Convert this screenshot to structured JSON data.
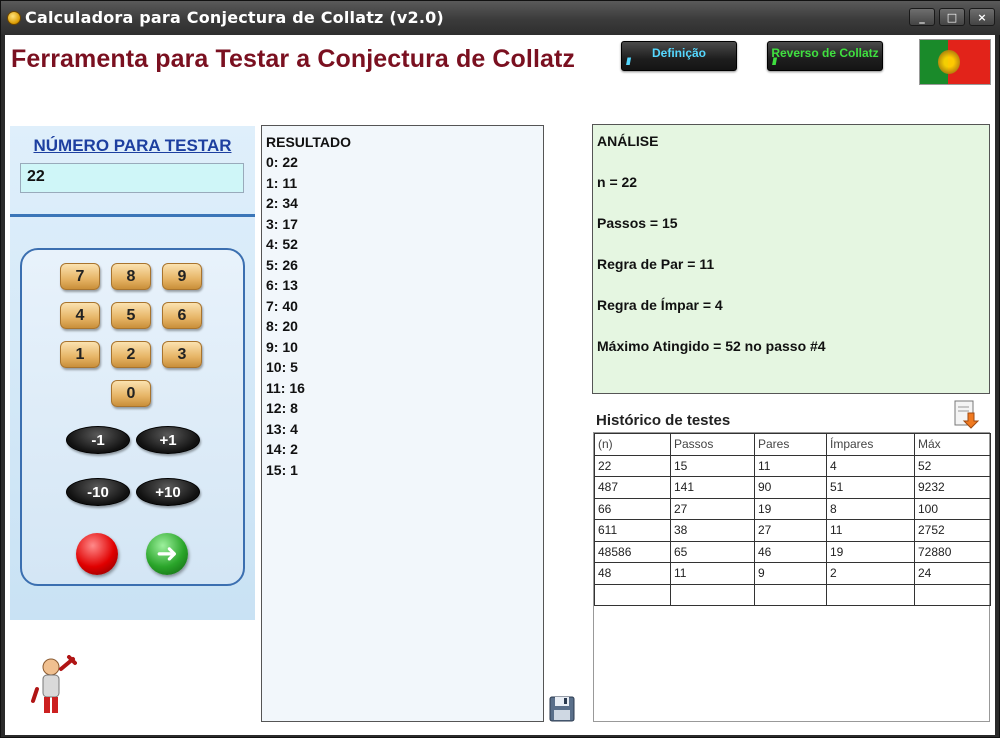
{
  "window": {
    "title": "Calculadora para Conjectura de Collatz  (v2.0)",
    "buttons": [
      "_",
      "□",
      "×"
    ]
  },
  "header": {
    "heading": "Ferramenta para Testar a Conjectura de Collatz",
    "btn_definicao": "Definição",
    "btn_reverso": "Reverso de Collatz"
  },
  "input": {
    "label": "NÚMERO PARA TESTAR",
    "value": "22"
  },
  "keypad": {
    "digits": [
      "7",
      "8",
      "9",
      "4",
      "5",
      "6",
      "1",
      "2",
      "3",
      "0"
    ],
    "minus1": "-1",
    "plus1": "+1",
    "minus10": "-10",
    "plus10": "+10"
  },
  "result": {
    "title": "RESULTADO",
    "lines": [
      "0: 22",
      "1: 11",
      "2: 34",
      "3: 17",
      "4: 52",
      "5: 26",
      "6: 13",
      "7: 40",
      "8: 20",
      "9: 10",
      "10: 5",
      "11: 16",
      "12: 8",
      "13: 4",
      "14: 2",
      "15: 1"
    ]
  },
  "analysis": {
    "title": "ANÁLISE",
    "n": "n = 22",
    "passos": "Passos = 15",
    "par": "Regra de Par = 11",
    "impar": "Regra de Ímpar = 4",
    "maximo": "Máximo Atingido = 52 no passo #4"
  },
  "history": {
    "title": "Histórico de testes",
    "columns": [
      "(n)",
      "Passos",
      "Pares",
      "Ímpares",
      "Máx"
    ],
    "rows": [
      [
        "22",
        "15",
        "11",
        "4",
        "52"
      ],
      [
        "487",
        "141",
        "90",
        "51",
        "9232"
      ],
      [
        "66",
        "27",
        "19",
        "8",
        "100"
      ],
      [
        "611",
        "38",
        "27",
        "11",
        "2752"
      ],
      [
        "48586",
        "65",
        "46",
        "19",
        "72880"
      ],
      [
        "48",
        "11",
        "9",
        "2",
        "24"
      ],
      [
        "",
        "",
        "",
        "",
        ""
      ]
    ]
  },
  "colors": {
    "heading": "#7a1020",
    "label_blue": "#1d3fa0",
    "analysis_bg": "#e5f6e1",
    "result_bg": "#f2f7fb"
  }
}
